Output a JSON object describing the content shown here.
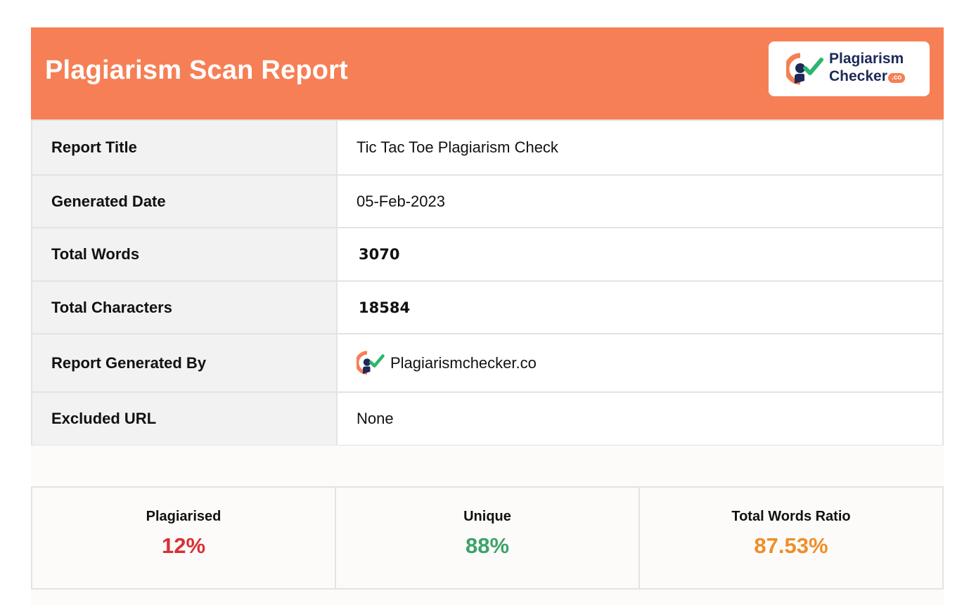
{
  "colors": {
    "accent": "#f67f55",
    "brand_navy": "#1d2a57",
    "check_green": "#2cb56f",
    "plagiarised": "#d93035",
    "unique": "#3ca36a",
    "ratio": "#ee8f28"
  },
  "header": {
    "title": "Plagiarism Scan Report",
    "logo": {
      "icon": "plagiarism-checker-logo-icon",
      "line1": "Plagiarism",
      "line2": "Checker",
      "tld": ".co"
    }
  },
  "report": {
    "rows": [
      {
        "label": "Report Title",
        "value": "Tic Tac Toe Plagiarism Check"
      },
      {
        "label": "Generated Date",
        "value": "05-Feb-2023"
      },
      {
        "label": "Total Words",
        "value": "3070"
      },
      {
        "label": "Total Characters",
        "value": "18584"
      },
      {
        "label": "Report Generated By",
        "value": "Plagiarismchecker.co"
      },
      {
        "label": "Excluded URL",
        "value": "None"
      }
    ]
  },
  "stats": [
    {
      "label": "Plagiarised",
      "value": "12%"
    },
    {
      "label": "Unique",
      "value": "88%"
    },
    {
      "label": "Total Words Ratio",
      "value": "87.53%"
    }
  ]
}
